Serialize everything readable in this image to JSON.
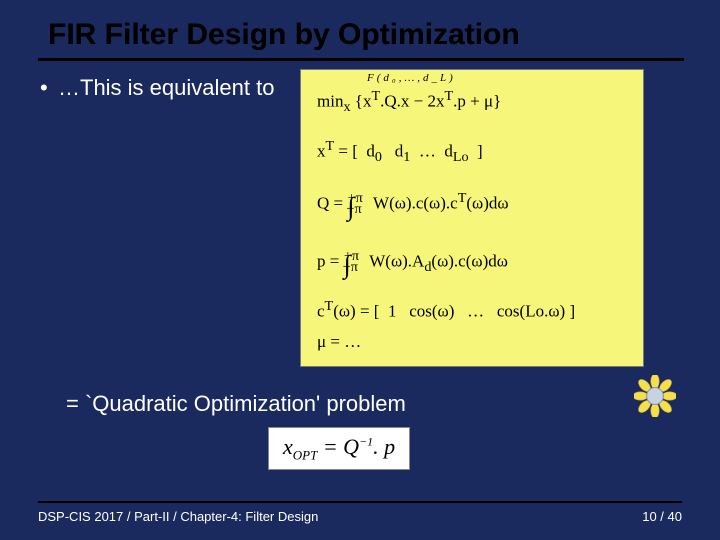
{
  "title": "FIR Filter Design by Optimization",
  "bullet": {
    "marker": "•",
    "text": "…This is equivalent to"
  },
  "math": {
    "overbrace_label": "F(d₀,…,d_L)",
    "line1_html": "min<sub>x</sub>&nbsp;{x<sup>T</sup>.Q.x − 2x<sup>T</sup>.p + μ}",
    "line2_html": "x<sup>T</sup> = [&nbsp; d<sub>0</sub>&nbsp;&nbsp; d<sub>1</sub>&nbsp; …&nbsp; d<sub>Lo</sub> &nbsp;]",
    "line3_html": "Q = <span class=\"int\">∫</span><sub style=\"margin-left:-8px\">−π</sub><sup style=\"margin-left:-14px;margin-right:6px\">+π</sup> W(ω).c(ω).c<sup>T</sup>(ω)dω",
    "line4_html": "p = <span class=\"int\">∫</span><sub style=\"margin-left:-8px\">−π</sub><sup style=\"margin-left:-14px;margin-right:6px\">+π</sup> W(ω).A<sub>d</sub>(ω).c(ω)dω",
    "line5_html": "c<sup>T</sup>(ω) = [&nbsp; 1&nbsp;&nbsp; cos(ω)&nbsp;&nbsp; …&nbsp;&nbsp; cos(Lo.ω) ]",
    "line6_html": "μ = …"
  },
  "qp_line": "= `Quadratic Optimization' problem",
  "solution_html": "x<sub style=\"font-style:italic;font-size:13px\">OPT</sub> = Q<sup style=\"font-size:12px\">−1</sup>. p",
  "footer": {
    "left": "DSP-CIS 2017  /  Part-II  /  Chapter-4: Filter Design",
    "right": "10 / 40"
  },
  "colors": {
    "slide_bg": "#1b265a",
    "math_bg": "#f6f67a",
    "text_light": "#ffffff",
    "text_dark": "#000000"
  }
}
